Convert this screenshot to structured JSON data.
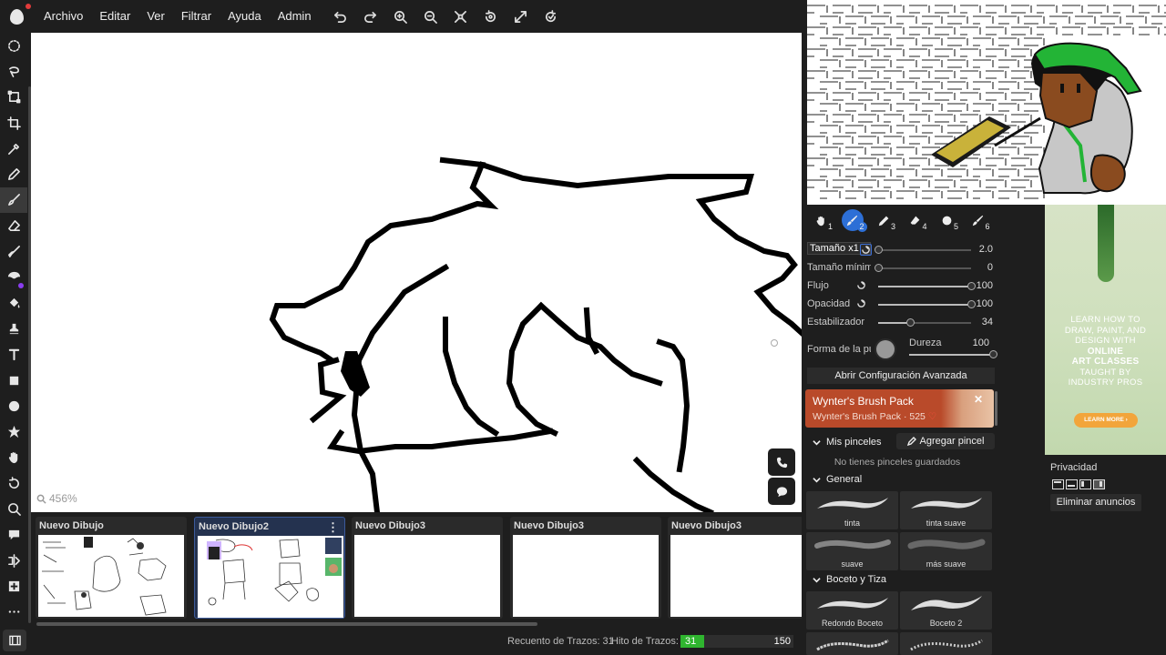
{
  "menubar": {
    "items": [
      "Archivo",
      "Editar",
      "Ver",
      "Filtrar",
      "Ayuda",
      "Admin"
    ],
    "icons": [
      "undo-icon",
      "redo-icon",
      "zoom-in-icon",
      "zoom-out-icon",
      "fit-icon",
      "rotate-icon",
      "fullscreen-icon",
      "reset-rotation-icon"
    ]
  },
  "left_tools": [
    "lasso-select-icon",
    "lasso-free-icon",
    "transform-icon",
    "crop-icon",
    "eyedropper-icon",
    "pen-icon",
    "brush-icon",
    "eraser-icon",
    "smudge-icon",
    "liquify-icon",
    "bucket-icon",
    "stamp-icon",
    "text-icon",
    "rect-icon",
    "ellipse-icon",
    "star-icon",
    "hand-icon",
    "rotate-icon",
    "zoom-icon",
    "comment-icon",
    "symmetry-icon",
    "add-icon",
    "more-icon"
  ],
  "canvas": {
    "zoom_label": "456%"
  },
  "documents": [
    {
      "title": "Nuevo Dibujo",
      "active": false
    },
    {
      "title": "Nuevo Dibujo2",
      "active": true
    },
    {
      "title": "Nuevo Dibujo3",
      "active": false
    },
    {
      "title": "Nuevo Dibujo3",
      "active": false
    },
    {
      "title": "Nuevo Dibujo3",
      "active": false
    }
  ],
  "status": {
    "stroke_count_label": "Recuento de Trazos: 31",
    "hit_label": "Hito de Trazos:",
    "hit_value": "31",
    "hit_max": "150",
    "hit_progress": 0.207
  },
  "brush": {
    "presets": [
      "1",
      "2",
      "3",
      "4",
      "5",
      "6"
    ],
    "active_preset": 2,
    "sliders": [
      {
        "label": "Tamaño x1",
        "value": "2.0",
        "pos": 0.0
      },
      {
        "label": "Tamaño mínimo",
        "value": "0",
        "pos": 0.0
      },
      {
        "label": "Flujo",
        "value": "100",
        "pos": 1.0
      },
      {
        "label": "Opacidad",
        "value": "100",
        "pos": 1.0
      },
      {
        "label": "Estabilizador",
        "value": "34",
        "pos": 0.34
      }
    ],
    "tip_label": "Forma de la punta",
    "hardness_label": "Dureza",
    "hardness_value": "100",
    "advanced_button": "Abrir Configuración Avanzada"
  },
  "promo": {
    "title": "Wynter's Brush Pack",
    "subtitle": "Wynter's Brush Pack · 525",
    "close": "✕"
  },
  "my_brushes": {
    "header": "Mis pinceles",
    "add_button": "Agregar pincel",
    "empty_text": "No tienes pinceles guardados"
  },
  "general": {
    "header": "General",
    "brushes": [
      "tinta",
      "tinta suave",
      "suave",
      "más suave"
    ]
  },
  "sketch": {
    "header": "Boceto y Tiza",
    "brushes": [
      "Redondo Boceto",
      "Boceto 2"
    ]
  },
  "ad": {
    "line1": "LEARN HOW TO",
    "line2": "DRAW, PAINT, AND",
    "line3": "DESIGN WITH",
    "line4": "ONLINE",
    "line5": "ART CLASSES",
    "line6": "TAUGHT BY",
    "line7": "INDUSTRY PROS",
    "button": "LEARN MORE ›",
    "privacy": "Privacidad",
    "remove_ads": "Eliminar anuncios"
  },
  "colors": {
    "accent": "#2d6fd6",
    "hit_green": "#2fb52f",
    "panel": "#1e1e1e"
  }
}
